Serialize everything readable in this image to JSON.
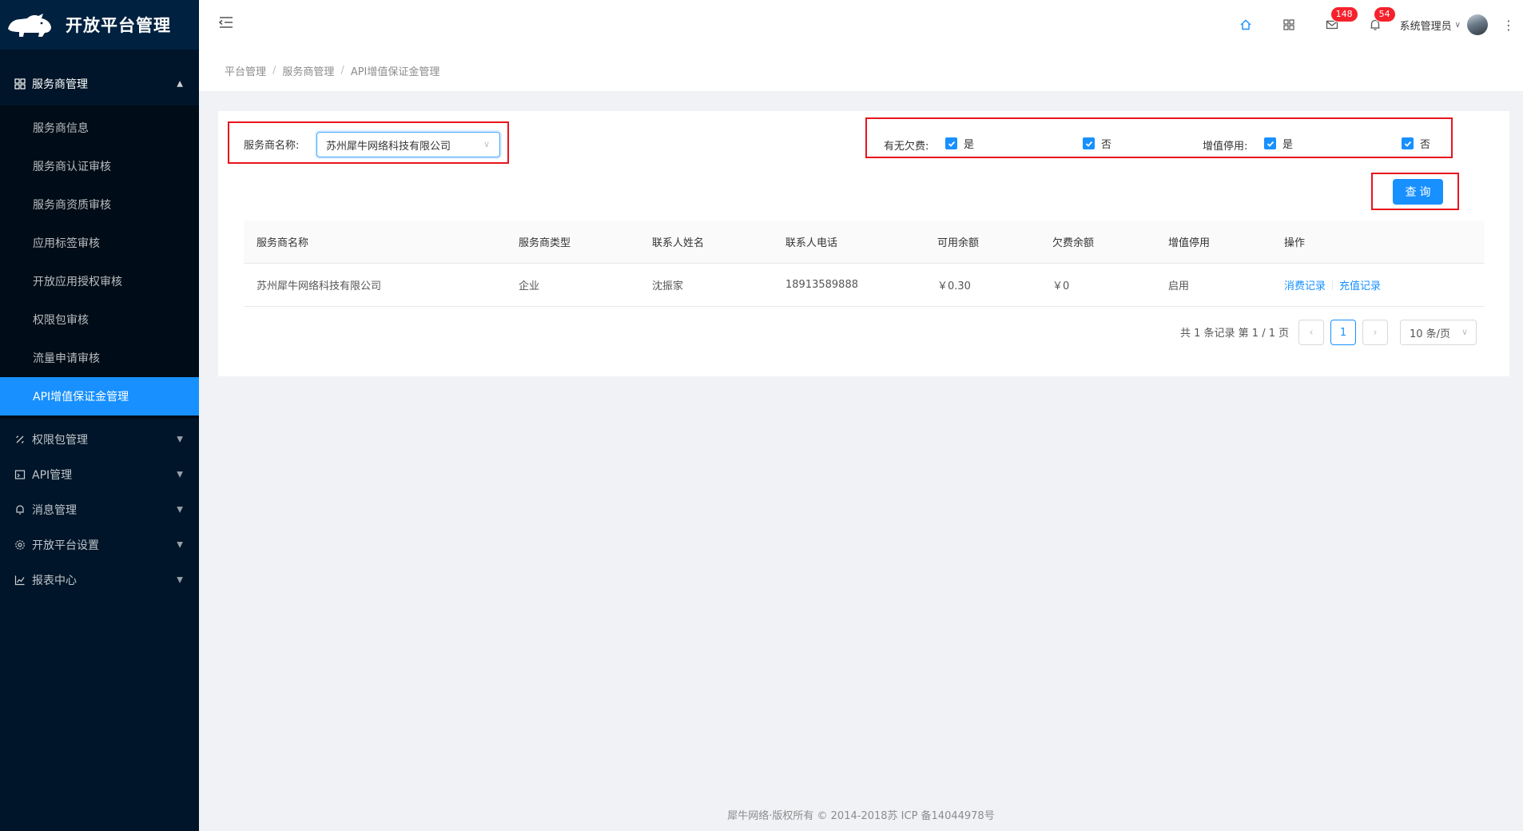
{
  "app": {
    "title": "开放平台管理"
  },
  "sidebar": {
    "group": {
      "label": "服务商管理",
      "icon": "appstore-icon",
      "items": [
        {
          "label": "服务商信息"
        },
        {
          "label": "服务商认证审核"
        },
        {
          "label": "服务商资质审核"
        },
        {
          "label": "应用标签审核"
        },
        {
          "label": "开放应用授权审核"
        },
        {
          "label": "权限包审核"
        },
        {
          "label": "流量申请审核"
        },
        {
          "label": "API增值保证金管理",
          "active": true
        }
      ]
    },
    "menus": [
      {
        "label": "权限包管理",
        "icon": "link-icon"
      },
      {
        "label": "API管理",
        "icon": "api-icon"
      },
      {
        "label": "消息管理",
        "icon": "bell-icon"
      },
      {
        "label": "开放平台设置",
        "icon": "setting-icon"
      },
      {
        "label": "报表中心",
        "icon": "line-chart-icon"
      }
    ]
  },
  "header": {
    "mail_badge": "148",
    "notice_badge": "54",
    "user_name": "系统管理员"
  },
  "breadcrumb": [
    "平台管理",
    "服务商管理",
    "API增值保证金管理"
  ],
  "filters": {
    "provider_label": "服务商名称:",
    "provider_value": "苏州犀牛网络科技有限公司",
    "arrears_label": "有无欠费:",
    "arrears_yes": "是",
    "arrears_no": "否",
    "stop_label": "增值停用:",
    "stop_yes": "是",
    "stop_no": "否",
    "query_button": "查询"
  },
  "table": {
    "columns": [
      "服务商名称",
      "服务商类型",
      "联系人姓名",
      "联系人电话",
      "可用余额",
      "欠费余额",
      "增值停用",
      "操作"
    ],
    "rows": [
      {
        "name": "苏州犀牛网络科技有限公司",
        "type": "企业",
        "contact": "沈振家",
        "phone": "18913589888",
        "balance": "￥0.30",
        "arrears": "￥0",
        "status": "启用",
        "action_consume": "消费记录",
        "action_recharge": "充值记录"
      }
    ]
  },
  "pagination": {
    "total_text": "共 1 条记录 第 1 / 1 页",
    "current_page": "1",
    "page_size": "10 条/页"
  },
  "footer": {
    "text": "犀牛网络·版权所有 © 2014-2018苏 ICP 备14044978号"
  },
  "colors": {
    "primary": "#1890ff",
    "sidebar_bg": "#001529",
    "highlight_box": "#e8151b",
    "badge": "#f5222d"
  }
}
